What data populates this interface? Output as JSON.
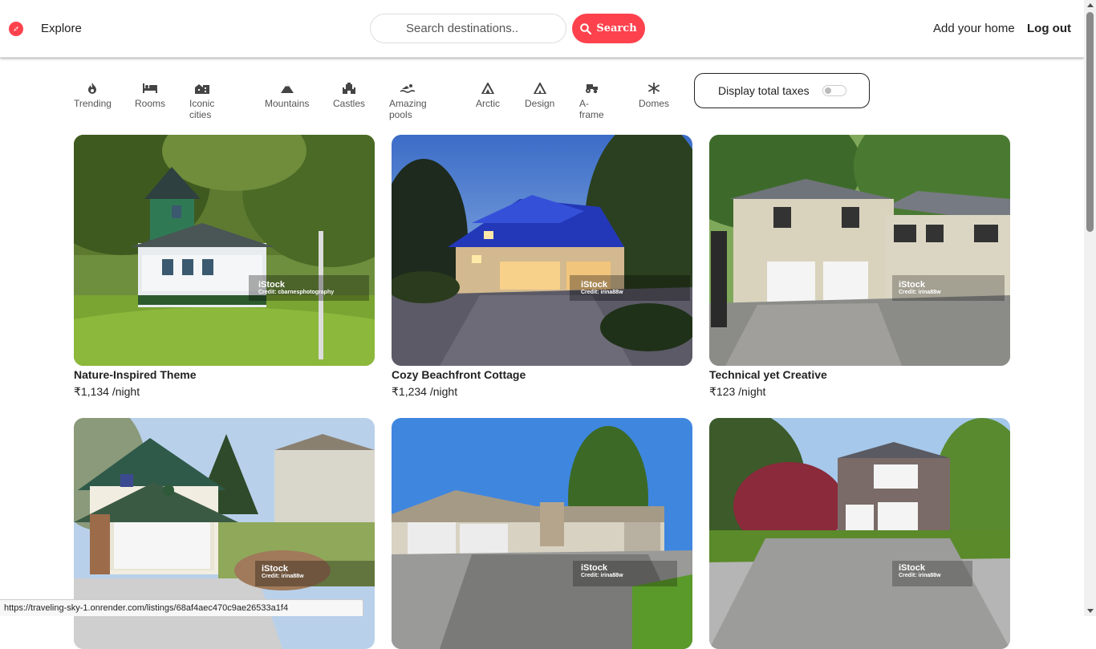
{
  "navbar": {
    "brand_icon": "compass-icon",
    "explore_label": "Explore",
    "search_placeholder": "Search destinations..",
    "search_button_label": "Search",
    "add_home_label": "Add your home",
    "logout_label": "Log out"
  },
  "filters": [
    {
      "label": "Trending",
      "icon": "fire-icon"
    },
    {
      "label": "Rooms",
      "icon": "bed-icon"
    },
    {
      "label": "Iconic cities",
      "icon": "city-icon"
    },
    {
      "label": "Mountains",
      "icon": "mountain-icon"
    },
    {
      "label": "Castles",
      "icon": "castle-icon"
    },
    {
      "label": "Amazing pools",
      "icon": "swimmer-icon"
    },
    {
      "label": "Arctic",
      "icon": "igloo-icon"
    },
    {
      "label": "Design",
      "icon": "tent-icon"
    },
    {
      "label": "A-frame",
      "icon": "tractor-icon"
    },
    {
      "label": "Domes",
      "icon": "snowflake-icon"
    }
  ],
  "tax_toggle": {
    "label": "Display total taxes",
    "enabled": false
  },
  "listings": [
    {
      "title": "Nature-Inspired Theme",
      "price": "₹1,134 /night",
      "watermark": "iStock",
      "credit": "Credit: cbarnesphotography"
    },
    {
      "title": "Cozy Beachfront Cottage",
      "price": "₹1,234 /night",
      "watermark": "iStock",
      "credit": "Credit: irina88w"
    },
    {
      "title": "Technical yet Creative",
      "price": "₹123 /night",
      "watermark": "iStock",
      "credit": "Credit: irina88w"
    },
    {
      "title": "",
      "price": "",
      "watermark": "iStock",
      "credit": "Credit: irina88w"
    },
    {
      "title": "",
      "price": "",
      "watermark": "iStock",
      "credit": "Credit: irina88w"
    },
    {
      "title": "",
      "price": "",
      "watermark": "iStock",
      "credit": "Credit: irina88w"
    }
  ],
  "status_url": "https://traveling-sky-1.onrender.com/listings/68af4aec470c9ae26533a1f4",
  "colors": {
    "accent": "#fe424d"
  }
}
